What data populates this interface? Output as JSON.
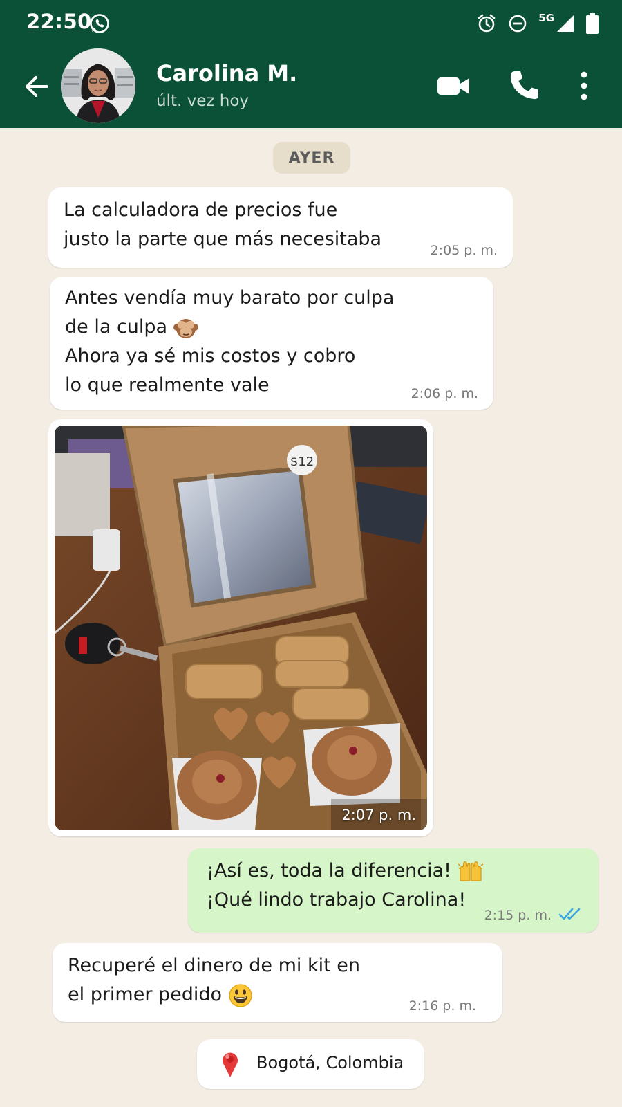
{
  "status_bar": {
    "time": "22:50",
    "network": "5G"
  },
  "header": {
    "contact_name": "Carolina M.",
    "contact_status": "últ. vez hoy",
    "accent": "#0b5137"
  },
  "chat": {
    "day_separator": "AYER",
    "messages": [
      {
        "text": "La calculadora de precios fue\njusto la parte que más necesitaba",
        "time": "2:05 p. m.",
        "direction": "in"
      },
      {
        "text_lines": [
          "Antes vendía muy barato por culpa",
          "de la culpa",
          "Ahora ya sé mis costos y cobro",
          "lo que realmente vale"
        ],
        "emoji": "see-no-evil-monkey",
        "time": "2:06 p. m.",
        "direction": "in"
      },
      {
        "type": "image",
        "price_tag": "$12",
        "time": "2:07 p. m.",
        "direction": "in"
      },
      {
        "text_lines": [
          "¡Así es, toda la diferencia!",
          "¡Qué lindo trabajo Carolina!"
        ],
        "emoji": "raising-hands",
        "time": "2:15 p. m.",
        "direction": "out",
        "read": true
      },
      {
        "text_lines": [
          "Recuperé el dinero de mi kit en",
          "el primer pedido"
        ],
        "emoji": "grinning-face",
        "time": "2:16 p. m.",
        "direction": "in"
      }
    ],
    "location": "Bogotá, Colombia"
  },
  "colors": {
    "background": "#f3ede4",
    "incoming_bubble": "#ffffff",
    "outgoing_bubble": "#d6f5c8",
    "read_ticks": "#3aa6e6"
  }
}
